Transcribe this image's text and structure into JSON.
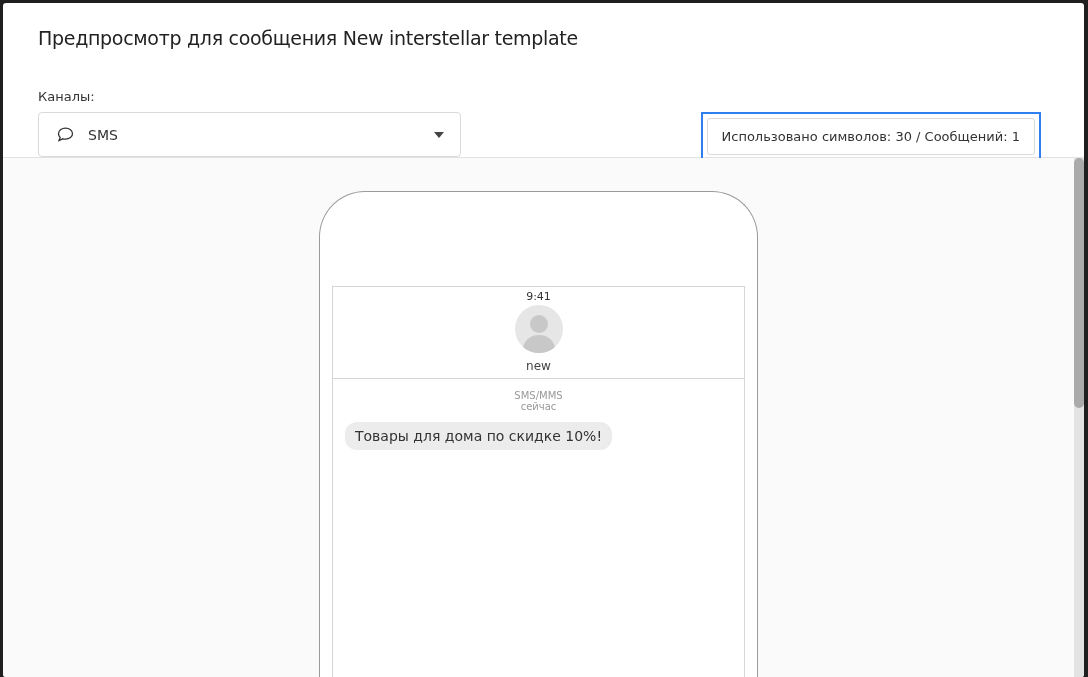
{
  "dialog": {
    "title": "Предпросмотр для сообщения New interstellar template"
  },
  "channel_select": {
    "label": "Каналы:",
    "value": "SMS"
  },
  "counter": {
    "text": "Использовано символов: 30 / Сообщений: 1",
    "focused": true
  },
  "phone": {
    "time": "9:41",
    "contact": "new",
    "service": "SMS/MMS",
    "timestamp": "сейчас",
    "messages": [
      {
        "text": "Товары для дома по скидке 10%!"
      }
    ]
  }
}
